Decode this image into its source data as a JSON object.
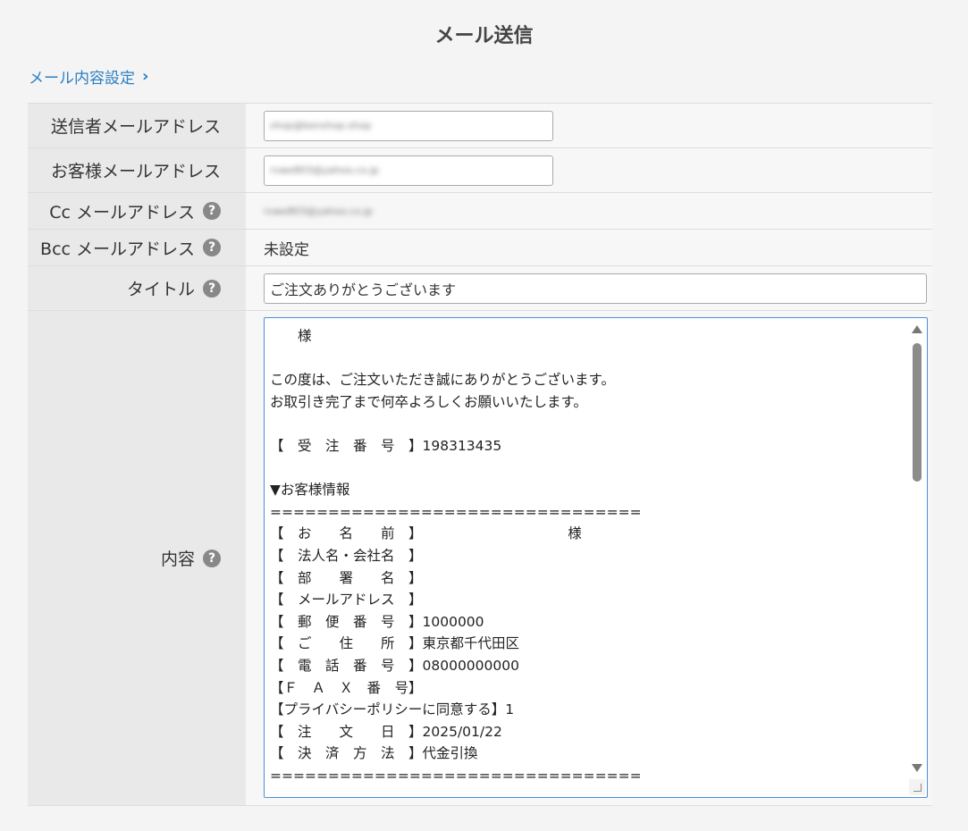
{
  "page_title": "メール送信",
  "settings_link": "メール内容設定",
  "form": {
    "sender_label": "送信者メールアドレス",
    "sender_value": "shop@kenshop.shop",
    "customer_label": "お客様メールアドレス",
    "customer_value": "rvwe803@yahoo.co.jp",
    "cc_label": "Cc メールアドレス",
    "cc_value": "rvwe803@yahoo.co.jp",
    "bcc_label": "Bcc メールアドレス",
    "bcc_value": "未設定",
    "title_label": "タイトル",
    "title_value": "ご注文ありがとうございます",
    "content_label": "内容",
    "content_lines": [
      "　　様",
      "",
      "この度は、ご注文いただき誠にありがとうございます。",
      "お取引き完了まで何卒よろしくお願いいたします。",
      "",
      "【　受　注　番　号　】198313435",
      "",
      "▼お客様情報",
      "================================",
      "【　お　　名　　前　】　　　　　　　　　　　様",
      "【　法人名・会社名　】",
      "【　部　　署　　名　】",
      "【　メールアドレス　】",
      "【　郵　便　番　号　】1000000",
      "【　ご　　住　　所　】東京都千代田区",
      "【　電　話　番　号　】08000000000",
      "【Ｆ　Ａ　Ｘ　番　号】",
      "【プライバシーポリシーに同意する】1",
      "【　注　　文　　日　】2025/01/22",
      "【　決　済　方　法　】代金引換",
      "================================"
    ]
  }
}
